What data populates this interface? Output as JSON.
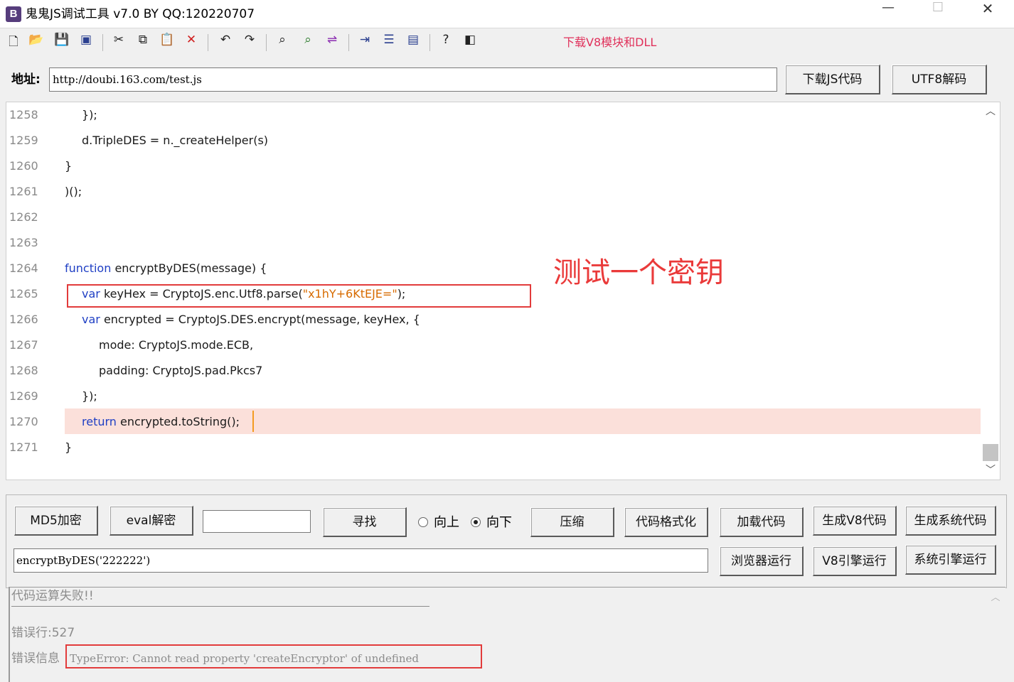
{
  "window": {
    "title": "鬼鬼JS调试工具 v7.0 BY QQ:120220707",
    "app_icon_letter": "B",
    "minimize": "—",
    "maximize": "☐",
    "close": "✕"
  },
  "toolbar": {
    "download_v8_link": "下载V8模块和DLL"
  },
  "address": {
    "label": "地址:",
    "value": "http://doubi.163.com/test.js",
    "download_js_button": "下载JS代码",
    "utf8_decode_button": "UTF8解码"
  },
  "editor": {
    "lines": [
      {
        "num": "1258",
        "text": "});"
      },
      {
        "num": "1259",
        "text": "d.TripleDES = n._createHelper(s)"
      },
      {
        "num": "1260",
        "text": "}"
      },
      {
        "num": "1261",
        "text": ")();"
      },
      {
        "num": "1262",
        "text": ""
      },
      {
        "num": "1263",
        "text": ""
      },
      {
        "num": "1264",
        "kw": "function",
        "text": " encryptByDES(message) {"
      },
      {
        "num": "1265",
        "kw": "var",
        "text": " keyHex = CryptoJS.enc.Utf8.parse(",
        "str": "\"x1hY+6KtEJE=\"",
        "tail": ");"
      },
      {
        "num": "1266",
        "kw": "var",
        "text": " encrypted = CryptoJS.DES.encrypt(message, keyHex, {"
      },
      {
        "num": "1267",
        "text": "mode: CryptoJS.mode.ECB,"
      },
      {
        "num": "1268",
        "text": "padding: CryptoJS.pad.Pkcs7"
      },
      {
        "num": "1269",
        "text": "});"
      },
      {
        "num": "1270",
        "kw": "return",
        "text": " encrypted.toString();"
      },
      {
        "num": "1271",
        "text": "}"
      }
    ],
    "annotation": "测试一个密钥"
  },
  "controls": {
    "md5_button": "MD5加密",
    "eval_button": "eval解密",
    "find_value": "",
    "find_button": "寻找",
    "radio_up": "向上",
    "radio_down": "向下",
    "radio_selected": "down",
    "compress_button": "压缩",
    "format_button": "代码格式化",
    "load_button": "加载代码",
    "gen_v8_button": "生成V8代码",
    "gen_sys_button": "生成系统代码",
    "command_value": "encryptByDES('222222')",
    "browser_run_button": "浏览器运行",
    "v8_run_button": "V8引擎运行",
    "sys_run_button": "系统引擎运行"
  },
  "output": {
    "fail": "代码运算失败!!",
    "error_line": "错误行:527",
    "error_info_label": "错误信息",
    "error_message": "TypeError: Cannot read property 'createEncryptor' of undefined"
  },
  "colors": {
    "keyword": "#1f3fc4",
    "string": "#d76b00",
    "highlight_line": "#fbe0da",
    "annotation_red": "#ea3a3a",
    "link_pink": "#e0315b"
  }
}
